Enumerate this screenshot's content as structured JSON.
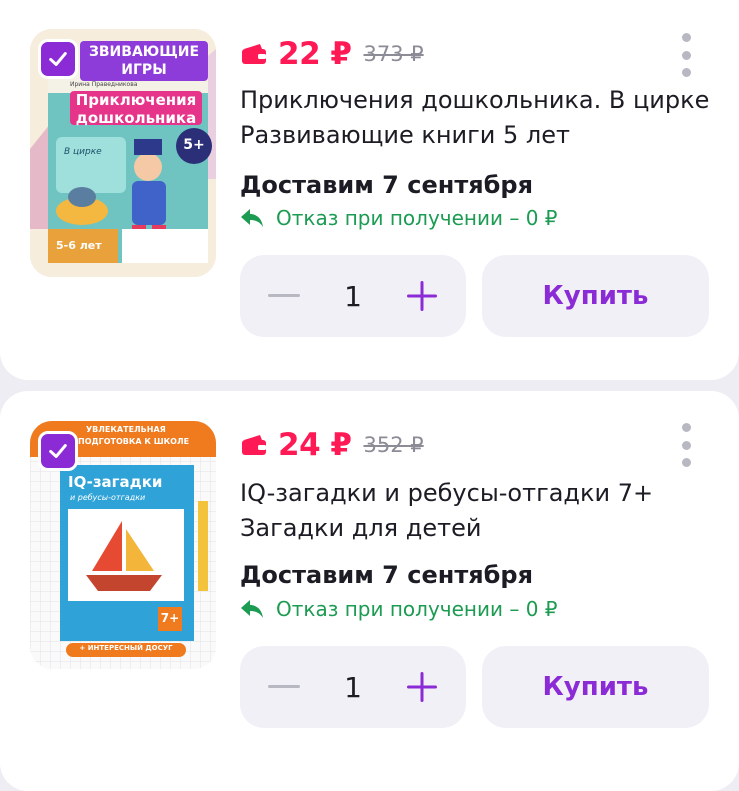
{
  "colors": {
    "accent_purple": "#8b2bd6",
    "price_red": "#ff1a55",
    "success_green": "#1c9b52",
    "background": "#efedf4"
  },
  "products": [
    {
      "price": "22 ₽",
      "old_price": "373 ₽",
      "title": "Приключения дошкольника. В цирке Развивающие книги 5 лет",
      "delivery": "Доставим 7 сентября",
      "refuse": "Отказ при получении – 0 ₽",
      "quantity": "1",
      "buy_label": "Купить",
      "selected": true,
      "cover": {
        "banner": "ЗВИВАЮЩИЕ ИГРЫ",
        "author": "Ирина Праведникова",
        "title_line1": "Приключения",
        "title_line2": "дошкольника",
        "subtitle": "В цирке",
        "age_badge": "5+",
        "age_range": "5-6 лет"
      }
    },
    {
      "price": "24 ₽",
      "old_price": "352 ₽",
      "title": "IQ-загадки и ребусы-отгадки 7+ Загадки для детей",
      "delivery": "Доставим 7 сентября",
      "refuse": "Отказ при получении – 0 ₽",
      "quantity": "1",
      "buy_label": "Купить",
      "selected": true,
      "cover": {
        "banner_line1": "УВЛЕКАТЕЛЬНАЯ",
        "banner_line2": "ПОДГОТОВКА К ШКОЛЕ",
        "title": "IQ-загадки",
        "subtitle": "и ребусы-отгадки",
        "age_badge": "7+",
        "footer": "+ ИНТЕРЕСНЫЙ ДОСУГ"
      }
    }
  ]
}
